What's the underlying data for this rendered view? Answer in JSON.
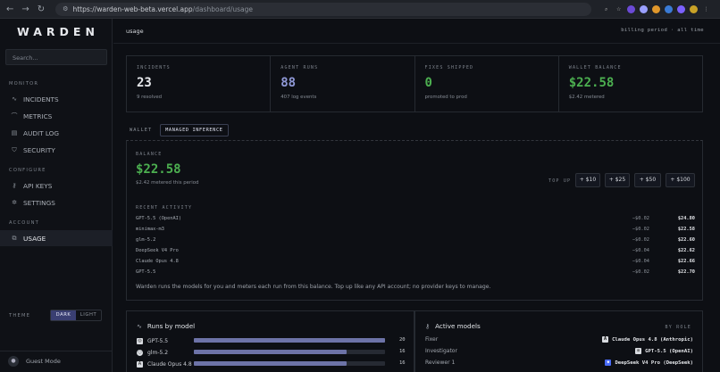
{
  "browser": {
    "url_host": "https://warden-web-beta.vercel.app",
    "url_path": "/dashboard/usage"
  },
  "sidebar": {
    "logo": "WARDEN",
    "search_placeholder": "Search...",
    "sections": [
      {
        "label": "MONITOR",
        "items": [
          {
            "label": "INCIDENTS",
            "icon": "activity-icon"
          },
          {
            "label": "METRICS",
            "icon": "chart-icon"
          },
          {
            "label": "AUDIT LOG",
            "icon": "log-icon"
          },
          {
            "label": "SECURITY",
            "icon": "shield-icon"
          }
        ]
      },
      {
        "label": "CONFIGURE",
        "items": [
          {
            "label": "API KEYS",
            "icon": "key-icon"
          },
          {
            "label": "SETTINGS",
            "icon": "gear-icon"
          }
        ]
      },
      {
        "label": "ACCOUNT",
        "items": [
          {
            "label": "USAGE",
            "icon": "usage-icon",
            "active": true
          }
        ]
      }
    ],
    "theme_label": "THEME",
    "theme_dark": "DARK",
    "theme_light": "LIGHT",
    "guest": "Guest Mode"
  },
  "header": {
    "title": "usage",
    "period": "billing period · all time"
  },
  "stats": [
    {
      "label": "INCIDENTS",
      "value": "23",
      "sub": "9 resolved",
      "color": "#e6e8ec"
    },
    {
      "label": "AGENT RUNS",
      "value": "88",
      "sub": "407 log events",
      "color": "#8f98d6"
    },
    {
      "label": "FIXES SHIPPED",
      "value": "0",
      "sub": "promoted to prod",
      "color": "#4caf50"
    },
    {
      "label": "WALLET BALANCE",
      "value": "$22.58",
      "sub": "$2.42 metered",
      "color": "#4caf50"
    }
  ],
  "tabs": {
    "wallet": "WALLET",
    "managed": "MANAGED INFERENCE"
  },
  "wallet": {
    "balance_label": "BALANCE",
    "balance": "$22.58",
    "balance_sub": "$2.42 metered this period",
    "topup_label": "TOP UP",
    "topups": [
      "+ $10",
      "+ $25",
      "+ $50",
      "+ $100"
    ],
    "activity_label": "RECENT ACTIVITY",
    "activity": [
      {
        "model": "GPT-5.5 (OpenAI)",
        "delta": "−$0.02",
        "balance": "$24.80"
      },
      {
        "model": "minimax-m3",
        "delta": "−$0.02",
        "balance": "$22.58"
      },
      {
        "model": "glm-5.2",
        "delta": "−$0.02",
        "balance": "$22.60"
      },
      {
        "model": "DeepSeek V4 Pro",
        "delta": "−$0.04",
        "balance": "$22.62"
      },
      {
        "model": "Claude Opus 4.8",
        "delta": "−$0.04",
        "balance": "$22.66"
      },
      {
        "model": "GPT-5.5",
        "delta": "−$0.02",
        "balance": "$22.70"
      }
    ],
    "note": "Warden runs the models for you and meters each run from this balance. Top up like any API account; no provider keys to manage."
  },
  "runs_by_model": {
    "title": "Runs by model",
    "rows": [
      {
        "name": "GPT-5.5",
        "count": "20",
        "fraction": 1.0
      },
      {
        "name": "glm-5.2",
        "count": "16",
        "fraction": 0.8
      },
      {
        "name": "Claude Opus 4.8",
        "count": "16",
        "fraction": 0.8
      }
    ]
  },
  "active_models": {
    "title": "Active models",
    "by_role": "BY ROLE",
    "rows": [
      {
        "role": "Fixer",
        "model": "Claude Opus 4.8 (Anthropic)"
      },
      {
        "role": "Investigator",
        "model": "GPT-5.5 (OpenAI)"
      },
      {
        "role": "Reviewer 1",
        "model": "DeepSeek V4 Pro (DeepSeek)"
      }
    ]
  }
}
